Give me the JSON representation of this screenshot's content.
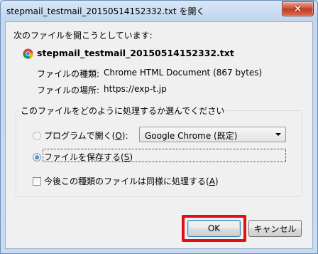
{
  "window": {
    "title": "stepmail_testmail_20150514152332.txt を開く",
    "close_glyph": "✕"
  },
  "dialog": {
    "intro": "次のファイルを開こうとしています:",
    "file_icon": "chrome-icon",
    "file_name": "stepmail_testmail_20150514152332.txt",
    "type_label": "ファイルの種類:",
    "type_value": "Chrome HTML Document (867 bytes)",
    "location_label": "ファイルの場所:",
    "location_value": "https://exp-t.jp"
  },
  "choice_group": {
    "legend": "このファイルをどのように処理するか選んでください",
    "open_with": {
      "label_prefix": "プログラムで開く(",
      "accel": "O",
      "label_suffix": "):",
      "selected": false,
      "program": "Google Chrome (既定)"
    },
    "save_file": {
      "label_prefix": "ファイルを保存する(",
      "accel": "S",
      "label_suffix": ")",
      "selected": true
    },
    "remember": {
      "label_prefix": "今後この種類のファイルは同様に処理する(",
      "accel": "A",
      "label_suffix": ")",
      "checked": false
    }
  },
  "buttons": {
    "ok": "OK",
    "cancel": "キャンセル"
  },
  "colors": {
    "highlight": "#e01010",
    "title_bar": "#c3d8ef",
    "close_button": "#c13a20"
  }
}
